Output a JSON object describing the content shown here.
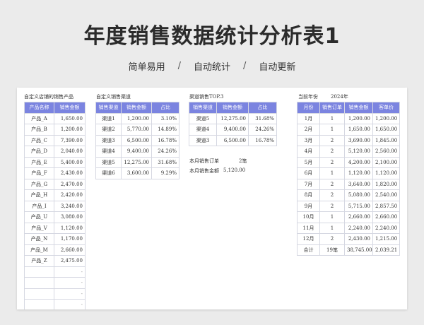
{
  "title": "年度销售数据统计分析表1",
  "subtitle": [
    "简单易用",
    "自动统计",
    "自动更新"
  ],
  "subtitle_sep": "/",
  "sheet": {
    "t1": {
      "label": "自定义店铺的销售产品",
      "headers": [
        "产品名称",
        "销售金额"
      ],
      "rows": [
        [
          "产品_A",
          "1,650.00"
        ],
        [
          "产品_B",
          "1,200.00"
        ],
        [
          "产品_C",
          "7,390.00"
        ],
        [
          "产品_D",
          "2,040.00"
        ],
        [
          "产品_E",
          "5,400.00"
        ],
        [
          "产品_F",
          "2,430.00"
        ],
        [
          "产品_G",
          "2,470.00"
        ],
        [
          "产品_H",
          "2,420.00"
        ],
        [
          "产品_I",
          "3,240.00"
        ],
        [
          "产品_U",
          "3,080.00"
        ],
        [
          "产品_V",
          "1,120.00"
        ],
        [
          "产品_N",
          "1,170.00"
        ],
        [
          "产品_M",
          "2,660.00"
        ],
        [
          "产品_Z",
          "2,475.00"
        ],
        [
          "",
          "-"
        ],
        [
          "",
          "-"
        ],
        [
          "",
          "-"
        ],
        [
          "",
          "-"
        ]
      ]
    },
    "t2": {
      "label": "自定义销售渠道",
      "headers": [
        "销售渠道",
        "销售金额",
        "占比"
      ],
      "rows": [
        [
          "渠道1",
          "1,200.00",
          "3.10%"
        ],
        [
          "渠道2",
          "5,770.00",
          "14.89%"
        ],
        [
          "渠道3",
          "6,500.00",
          "16.78%"
        ],
        [
          "渠道4",
          "9,400.00",
          "24.26%"
        ],
        [
          "渠道5",
          "12,275.00",
          "31.68%"
        ],
        [
          "渠道6",
          "3,600.00",
          "9.29%"
        ]
      ]
    },
    "t3": {
      "label": "渠道销售TOP.3",
      "headers": [
        "销售渠道",
        "销售金额",
        "占比"
      ],
      "rows": [
        [
          "渠道5",
          "12,275.00",
          "31.68%"
        ],
        [
          "渠道4",
          "9,400.00",
          "24.26%"
        ],
        [
          "渠道3",
          "6,500.00",
          "16.78%"
        ]
      ]
    },
    "monthly_orders": {
      "label": "本月销售订单",
      "value": "2笔"
    },
    "monthly_amount": {
      "label": "本月销售金额",
      "value": "5,120.00"
    },
    "year": {
      "label": "当前年份",
      "value": "2024年"
    },
    "t4": {
      "headers": [
        "月份",
        "销售订单",
        "销售金额",
        "客单价"
      ],
      "rows": [
        [
          "1月",
          "1",
          "1,200.00",
          "1,200.00"
        ],
        [
          "2月",
          "1",
          "1,650.00",
          "1,650.00"
        ],
        [
          "3月",
          "2",
          "3,690.00",
          "1,845.00"
        ],
        [
          "4月",
          "2",
          "5,120.00",
          "2,560.00"
        ],
        [
          "5月",
          "2",
          "4,200.00",
          "2,100.00"
        ],
        [
          "6月",
          "1",
          "1,120.00",
          "1,120.00"
        ],
        [
          "7月",
          "2",
          "3,640.00",
          "1,820.00"
        ],
        [
          "8月",
          "2",
          "5,080.00",
          "2,540.00"
        ],
        [
          "9月",
          "2",
          "5,715.00",
          "2,857.50"
        ],
        [
          "10月",
          "1",
          "2,660.00",
          "2,660.00"
        ],
        [
          "11月",
          "1",
          "2,240.00",
          "2,240.00"
        ],
        [
          "12月",
          "2",
          "2,430.00",
          "1,215.00"
        ],
        [
          "合计",
          "19笔",
          "38,745.00",
          "2,039.21"
        ]
      ]
    }
  }
}
